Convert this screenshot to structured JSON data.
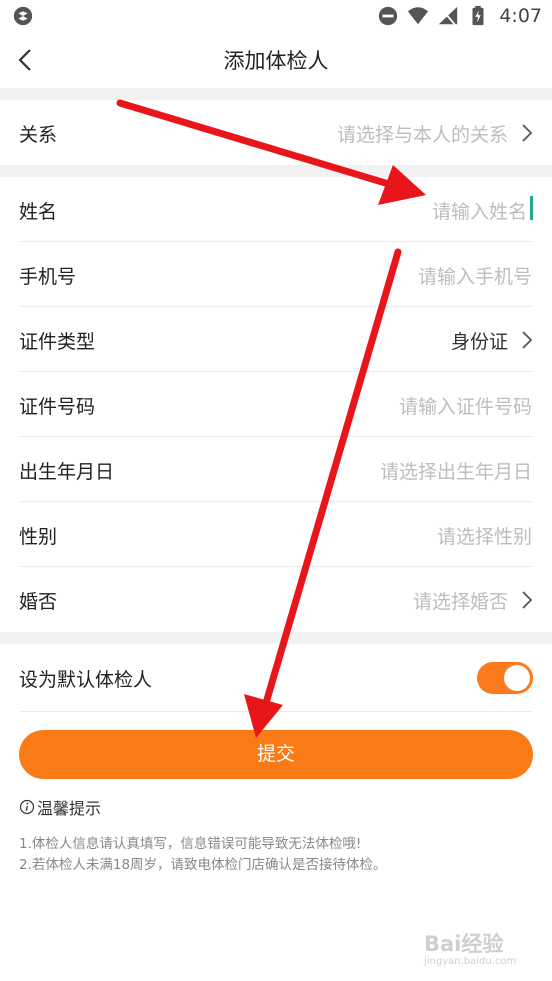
{
  "status_bar": {
    "time": "4:07"
  },
  "nav": {
    "title": "添加体检人"
  },
  "relation": {
    "label": "关系",
    "placeholder": "请选择与本人的关系"
  },
  "form": {
    "name": {
      "label": "姓名",
      "placeholder": "请输入姓名"
    },
    "phone": {
      "label": "手机号",
      "placeholder": "请输入手机号"
    },
    "id_type": {
      "label": "证件类型",
      "value": "身份证"
    },
    "id_number": {
      "label": "证件号码",
      "placeholder": "请输入证件号码"
    },
    "birthday": {
      "label": "出生年月日",
      "placeholder": "请选择出生年月日"
    },
    "gender": {
      "label": "性别",
      "placeholder": "请选择性别"
    },
    "marital": {
      "label": "婚否",
      "placeholder": "请选择婚否"
    }
  },
  "default_person": {
    "label": "设为默认体检人",
    "enabled": true
  },
  "submit_label": "提交",
  "tips": {
    "title": "温馨提示",
    "lines": [
      "1.体检人信息请认真填写，信息错误可能导致无法体检哦!",
      "2.若体检人未满18周岁，请致电体检门店确认是否接待体检。"
    ]
  },
  "watermark": {
    "brand": "Bai经验",
    "url": "jingyan.baidu.com"
  },
  "colors": {
    "accent": "#fa7a16",
    "annotation_arrow": "#e8161b",
    "caret": "#26a69a"
  }
}
